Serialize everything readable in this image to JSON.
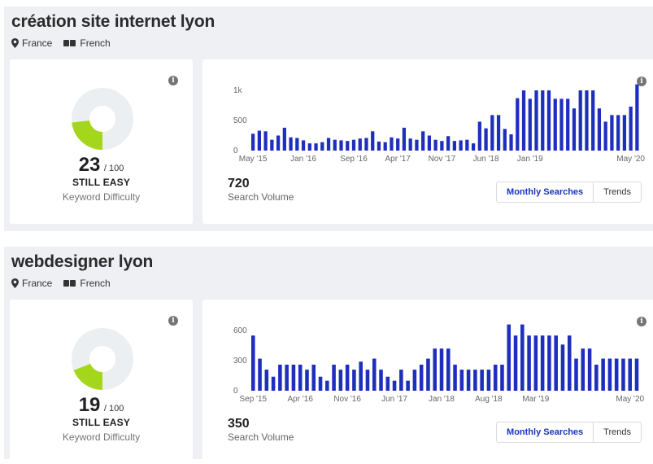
{
  "colors": {
    "bar": "#1f2fbd",
    "donut_fill": "#a4d61c",
    "donut_track": "#eceff1"
  },
  "keywords": [
    {
      "title": "création site internet lyon",
      "country": "France",
      "language": "French",
      "difficulty": {
        "score": "23",
        "max": "/ 100",
        "level": "STILL EASY",
        "label": "Keyword Difficulty",
        "fraction": 0.23
      },
      "volume": {
        "value": "720",
        "label": "Search Volume"
      },
      "tabs": {
        "monthly": "Monthly Searches",
        "trends": "Trends"
      },
      "chart_data": {
        "type": "bar",
        "yticks": [
          "1k",
          "500",
          "0"
        ],
        "ylim": [
          0,
          1000
        ],
        "tick_values": [
          1000,
          500,
          0
        ],
        "xticks": [
          {
            "label": "May '15",
            "index": 0
          },
          {
            "label": "Jan '16",
            "index": 8
          },
          {
            "label": "Sep '16",
            "index": 16
          },
          {
            "label": "Apr '17",
            "index": 23
          },
          {
            "label": "Nov '17",
            "index": 30
          },
          {
            "label": "Jun '18",
            "index": 37
          },
          {
            "label": "Jan '19",
            "index": 44
          },
          {
            "label": "May '20",
            "index": 60
          }
        ],
        "values": [
          280,
          330,
          320,
          180,
          250,
          380,
          220,
          210,
          170,
          120,
          120,
          140,
          210,
          180,
          170,
          160,
          180,
          200,
          210,
          320,
          150,
          140,
          220,
          200,
          380,
          200,
          180,
          320,
          250,
          180,
          160,
          240,
          160,
          170,
          180,
          120,
          480,
          370,
          590,
          590,
          360,
          270,
          870,
          1000,
          860,
          1000,
          1000,
          1000,
          860,
          860,
          860,
          700,
          1000,
          1000,
          1000,
          700,
          480,
          590,
          590,
          590,
          730,
          1100
        ]
      }
    },
    {
      "title": "webdesigner lyon",
      "country": "France",
      "language": "French",
      "difficulty": {
        "score": "19",
        "max": "/ 100",
        "level": "STILL EASY",
        "label": "Keyword Difficulty",
        "fraction": 0.19
      },
      "volume": {
        "value": "350",
        "label": "Search Volume"
      },
      "tabs": {
        "monthly": "Monthly Searches",
        "trends": "Trends"
      },
      "chart_data": {
        "type": "bar",
        "yticks": [
          "600",
          "300",
          "0"
        ],
        "ylim": [
          0,
          600
        ],
        "tick_values": [
          600,
          300,
          0
        ],
        "xticks": [
          {
            "label": "Sep '15",
            "index": 0
          },
          {
            "label": "Apr '16",
            "index": 7
          },
          {
            "label": "Nov '16",
            "index": 14
          },
          {
            "label": "Jun '17",
            "index": 21
          },
          {
            "label": "Jan '18",
            "index": 28
          },
          {
            "label": "Aug '18",
            "index": 35
          },
          {
            "label": "Mar '19",
            "index": 42
          },
          {
            "label": "May '20",
            "index": 56
          }
        ],
        "values": [
          550,
          320,
          210,
          140,
          260,
          260,
          260,
          260,
          210,
          260,
          140,
          100,
          260,
          210,
          260,
          210,
          290,
          210,
          320,
          210,
          140,
          100,
          210,
          100,
          210,
          260,
          320,
          420,
          420,
          420,
          260,
          210,
          210,
          210,
          210,
          210,
          260,
          260,
          660,
          550,
          660,
          550,
          550,
          550,
          550,
          550,
          460,
          550,
          320,
          420,
          420,
          260,
          320,
          320,
          320,
          320,
          320,
          320
        ]
      }
    }
  ]
}
